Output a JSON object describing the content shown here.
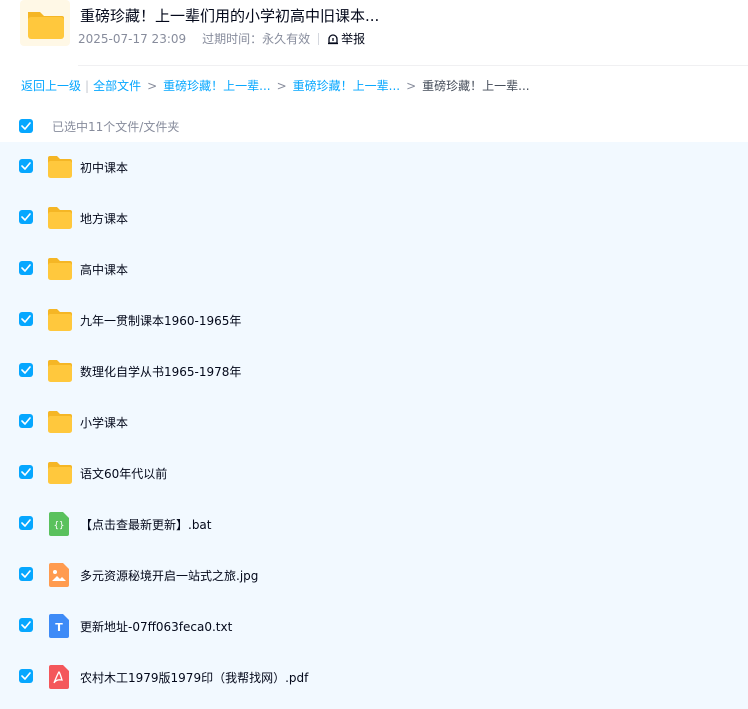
{
  "share": {
    "title": "重磅珍藏！上一辈们用的小学初高中旧课本...",
    "date": "2025-07-17 23:09",
    "expire_label": "过期时间：",
    "expire_value": "永久有效",
    "report_label": "举报"
  },
  "breadcrumb": {
    "back": "返回上一级",
    "all_files": "全部文件",
    "level1": "重磅珍藏！上一辈...",
    "level2": "重磅珍藏！上一辈...",
    "current": "重磅珍藏！上一辈..."
  },
  "selection": {
    "label": "已选中11个文件/文件夹"
  },
  "files": [
    {
      "name": "初中课本",
      "icon": "folder-icon"
    },
    {
      "name": "地方课本",
      "icon": "folder-icon"
    },
    {
      "name": "高中课本",
      "icon": "folder-icon"
    },
    {
      "name": "九年一贯制课本1960-1965年",
      "icon": "folder-icon"
    },
    {
      "name": "数理化自学从书1965-1978年",
      "icon": "folder-icon"
    },
    {
      "name": "小学课本",
      "icon": "folder-icon"
    },
    {
      "name": "语文60年代以前",
      "icon": "folder-icon"
    },
    {
      "name": "【点击查最新更新】.bat",
      "icon": "code-file-icon"
    },
    {
      "name": "多元资源秘境开启一站式之旅.jpg",
      "icon": "image-file-icon"
    },
    {
      "name": "更新地址-07ff063feca0.txt",
      "icon": "text-file-icon"
    },
    {
      "name": "农村木工1979版1979印（我帮找网）.pdf",
      "icon": "pdf-file-icon"
    }
  ],
  "colors": {
    "accent": "#06a7ff",
    "list_background": "#f2f9ff",
    "folder_yellow": "#ffc83d",
    "bat_green": "#5ac15d",
    "jpg_orange": "#ff9b4f",
    "txt_blue": "#3e8bf7",
    "pdf_red": "#f4575b"
  }
}
